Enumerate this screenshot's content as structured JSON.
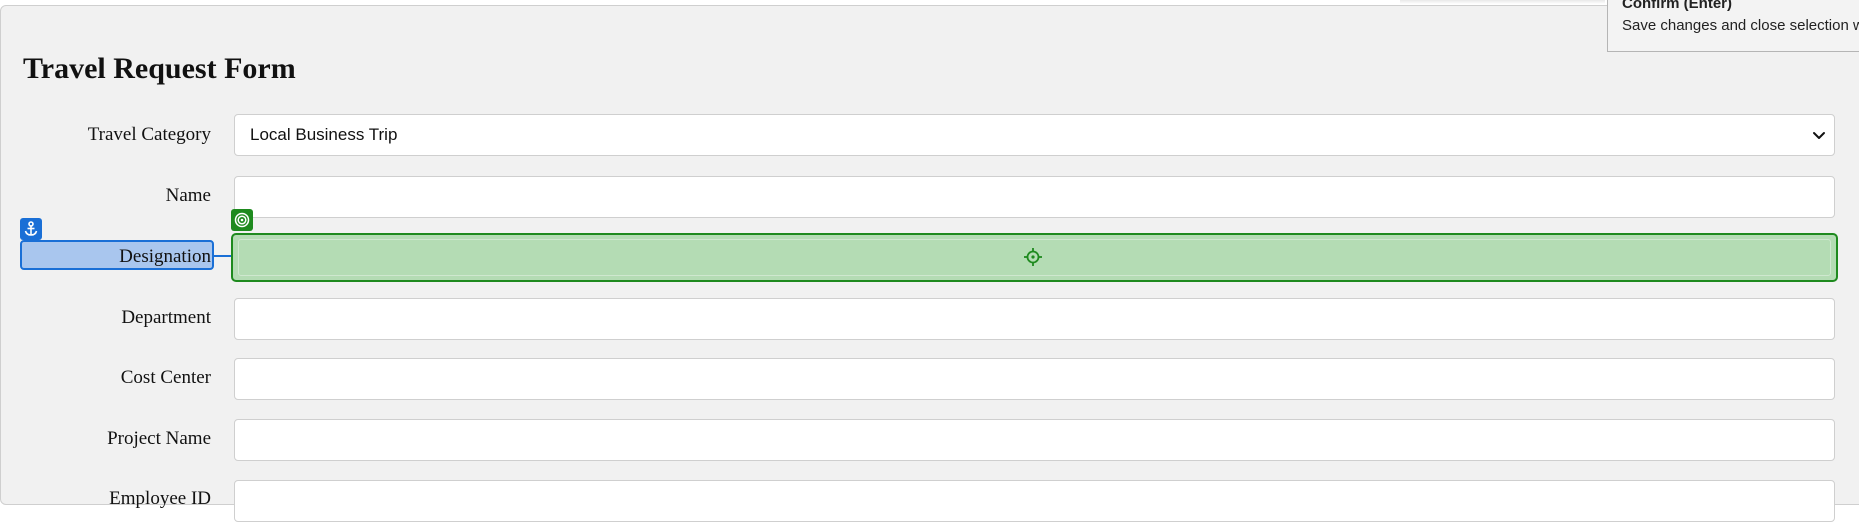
{
  "form": {
    "title": "Travel Request Form",
    "fields": [
      {
        "label": "Travel Category",
        "type": "select",
        "value": "Local Business Trip"
      },
      {
        "label": "Name",
        "type": "text",
        "value": ""
      },
      {
        "label": "Designation",
        "type": "text",
        "value": ""
      },
      {
        "label": "Department",
        "type": "text",
        "value": ""
      },
      {
        "label": "Cost Center",
        "type": "text",
        "value": ""
      },
      {
        "label": "Project Name",
        "type": "text",
        "value": ""
      },
      {
        "label": "Employee ID",
        "type": "text",
        "value": ""
      }
    ]
  },
  "tooltip": {
    "title": "Confirm (Enter)",
    "description": "Save changes and close selection wi"
  },
  "overlay": {
    "anchor_color": "#1a6fd6",
    "target_color": "#1e8a1e",
    "anchor_icon": "anchor-icon",
    "target_icon": "target-icon",
    "center_icon": "crosshair-icon"
  }
}
